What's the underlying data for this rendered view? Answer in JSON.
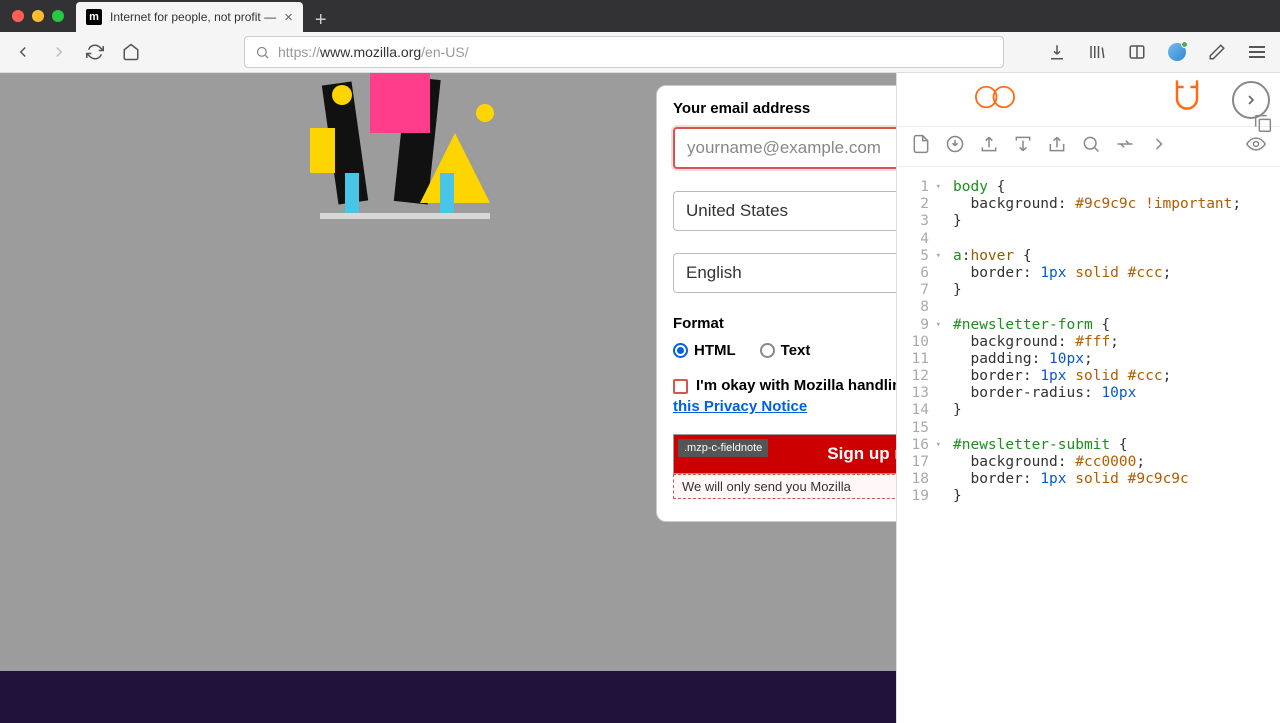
{
  "chrome": {
    "tab_title": "Internet for people, not profit —",
    "tab_favicon_letter": "m",
    "url_scheme": "https://",
    "url_host": "www.mozilla.org",
    "url_path": "/en-US/"
  },
  "form": {
    "email_label": "Your email address",
    "email_placeholder": "yourname@example.com",
    "country_value": "United States",
    "language_value": "English",
    "format_label": "Format",
    "format_html": "HTML",
    "format_text": "Text",
    "consent_text": "I'm okay with Mozilla handling",
    "privacy_link": "this Privacy Notice",
    "submit_label": "Sign up n",
    "inspector_tag": ".mzp-c-fieldnote",
    "fieldnote_text": "We will only send you Mozilla"
  },
  "editor": {
    "lines": [
      {
        "n": 1,
        "fold": true,
        "html": "<span class='tok-sel'>body</span> {"
      },
      {
        "n": 2,
        "fold": false,
        "html": "  <span class='tok-prop'>background</span>: <span class='tok-hex'>#9c9c9c</span> <span class='tok-imp'>!important</span>;"
      },
      {
        "n": 3,
        "fold": false,
        "html": "}"
      },
      {
        "n": 4,
        "fold": false,
        "html": ""
      },
      {
        "n": 5,
        "fold": true,
        "html": "<span class='tok-sel'>a</span>:<span class='tok-pseudo'>hover</span> {"
      },
      {
        "n": 6,
        "fold": false,
        "html": "  <span class='tok-prop'>border</span>: <span class='tok-num'>1px</span> <span class='tok-val'>solid</span> <span class='tok-hex'>#ccc</span>;"
      },
      {
        "n": 7,
        "fold": false,
        "html": "}"
      },
      {
        "n": 8,
        "fold": false,
        "html": ""
      },
      {
        "n": 9,
        "fold": true,
        "html": "<span class='tok-sel'>#newsletter-form</span> {"
      },
      {
        "n": 10,
        "fold": false,
        "html": "  <span class='tok-prop'>background</span>: <span class='tok-hex'>#fff</span>;"
      },
      {
        "n": 11,
        "fold": false,
        "html": "  <span class='tok-prop'>padding</span>: <span class='tok-num'>10px</span>;"
      },
      {
        "n": 12,
        "fold": false,
        "html": "  <span class='tok-prop'>border</span>: <span class='tok-num'>1px</span> <span class='tok-val'>solid</span> <span class='tok-hex'>#ccc</span>;"
      },
      {
        "n": 13,
        "fold": false,
        "html": "  <span class='tok-prop'>border-radius</span>: <span class='tok-num'>10px</span>"
      },
      {
        "n": 14,
        "fold": false,
        "html": "}"
      },
      {
        "n": 15,
        "fold": false,
        "html": ""
      },
      {
        "n": 16,
        "fold": true,
        "html": "<span class='tok-sel'>#newsletter-submit</span> {"
      },
      {
        "n": 17,
        "fold": false,
        "html": "  <span class='tok-prop'>background</span>: <span class='tok-hex'>#cc0000</span>;"
      },
      {
        "n": 18,
        "fold": false,
        "html": "  <span class='tok-prop'>border</span>: <span class='tok-num'>1px</span> <span class='tok-val'>solid</span> <span class='tok-hex'>#9c9c9c</span>"
      },
      {
        "n": 19,
        "fold": false,
        "html": "}"
      }
    ]
  }
}
